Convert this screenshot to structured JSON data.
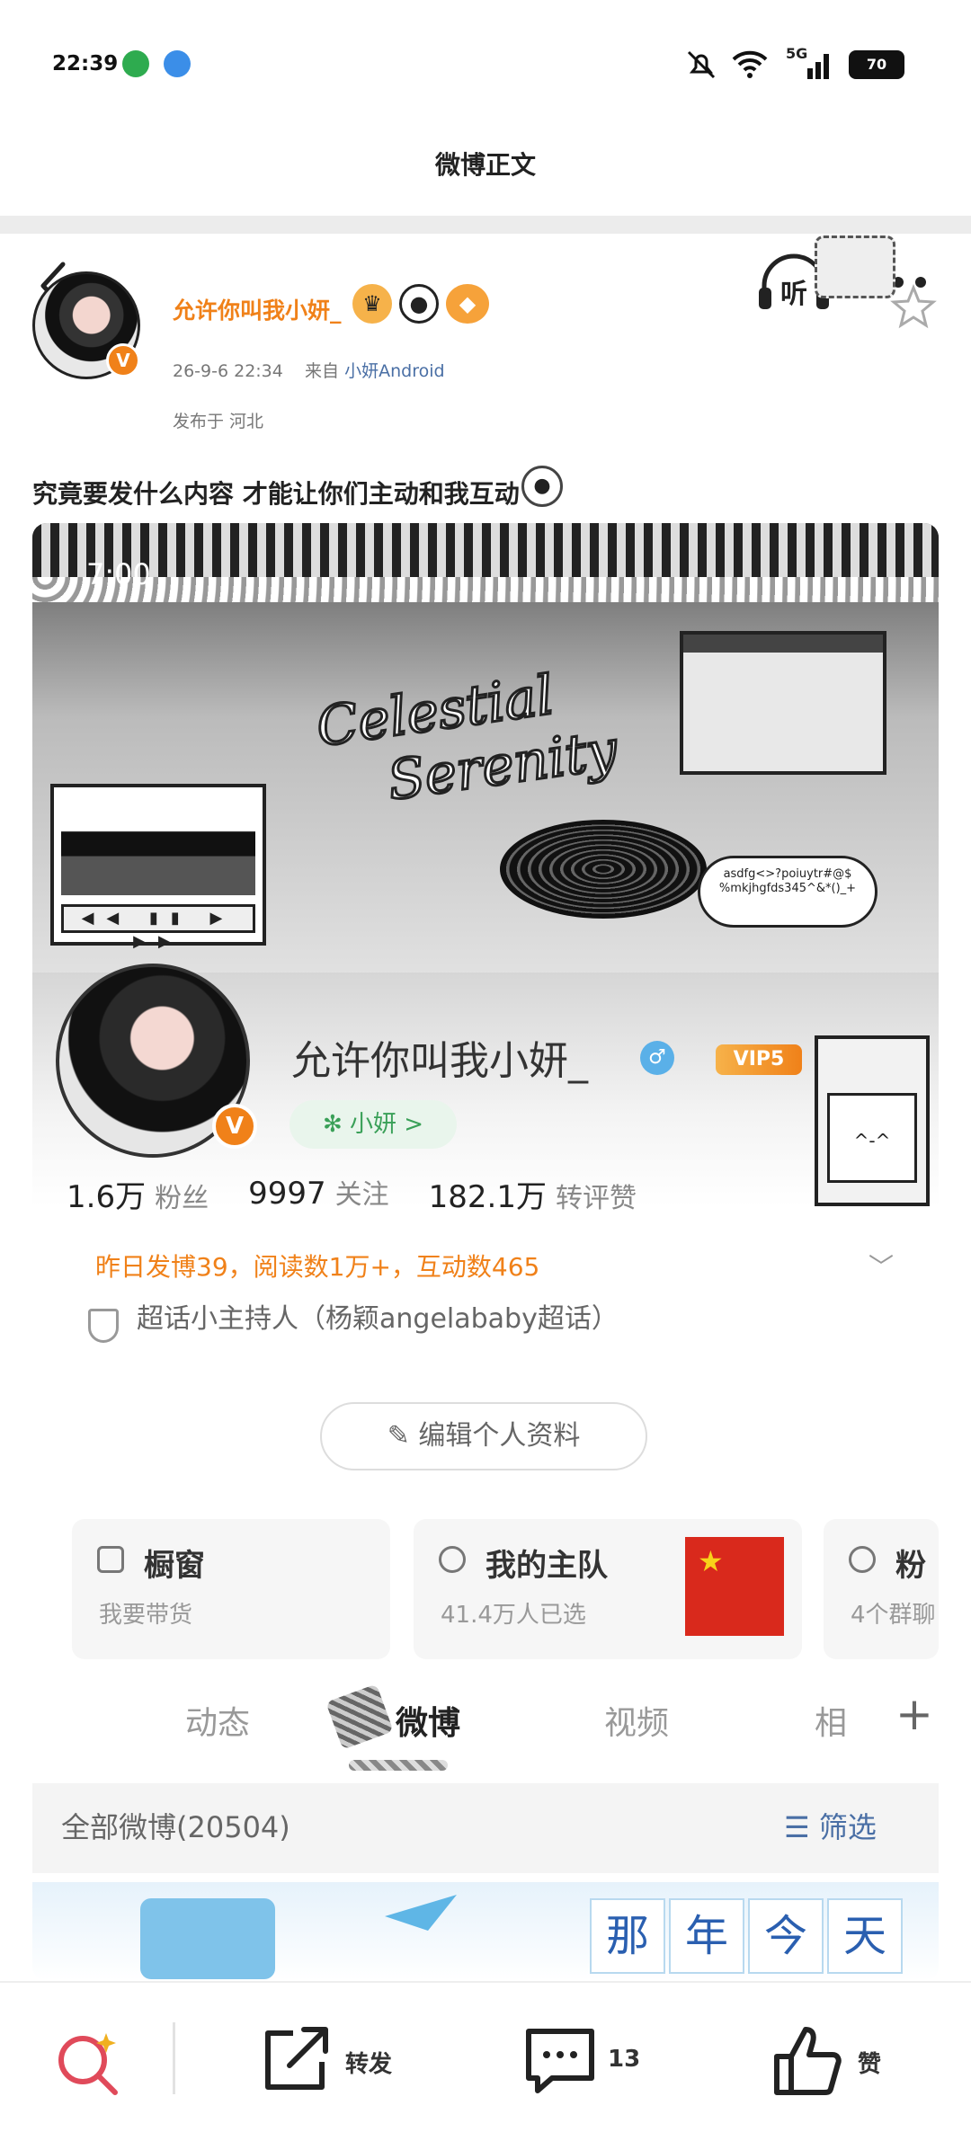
{
  "status_bar": {
    "time": "22:39",
    "battery": "70",
    "network": "5G"
  },
  "nav": {
    "title": "微博正文",
    "listen_label": "听"
  },
  "post": {
    "author": "允许你叫我小妍_",
    "date": "26-9-6 22:34",
    "source_prefix": "来自",
    "source": "小妍Android",
    "location": "发布于 河北",
    "text": "究竟要发什么内容 才能让你们主动和我互动"
  },
  "embedded_profile": {
    "banner_status_time": "7:00",
    "banner_title_line1": "Celestial",
    "banner_title_line2": "Serenity",
    "banner_note": "asdfg<>?poiuytr#@$ %mkjhgfds345^&*()_+",
    "name": "允许你叫我小妍_",
    "vip": "VIP5",
    "chip": "✻ 小妍 >",
    "stats": [
      {
        "value": "1.6万",
        "label": "粉丝"
      },
      {
        "value": "9997",
        "label": "关注"
      },
      {
        "value": "182.1万",
        "label": "转评赞"
      }
    ],
    "activity": "昨日发博39，阅读数1万+，互动数465",
    "host": "超话小主持人（杨颖angelababy超话）",
    "edit_button": "编辑个人资料",
    "cards": [
      {
        "title": "橱窗",
        "sub": "我要带货"
      },
      {
        "title": "我的主队",
        "sub": "41.4万人已选"
      },
      {
        "title": "粉",
        "sub": "4个群聊"
      }
    ],
    "tabs": [
      "动态",
      "微博",
      "视频",
      "相"
    ],
    "active_tab": "微博",
    "all_posts": "全部微博(20504)",
    "filter": "筛选",
    "memory": [
      "那",
      "年",
      "今",
      "天"
    ]
  },
  "bottom_bar": {
    "repost": "转发",
    "comments": "13",
    "like": "赞"
  },
  "colors": {
    "accent": "#f08119",
    "link": "#4a6fa5",
    "green": "#3aa058"
  }
}
